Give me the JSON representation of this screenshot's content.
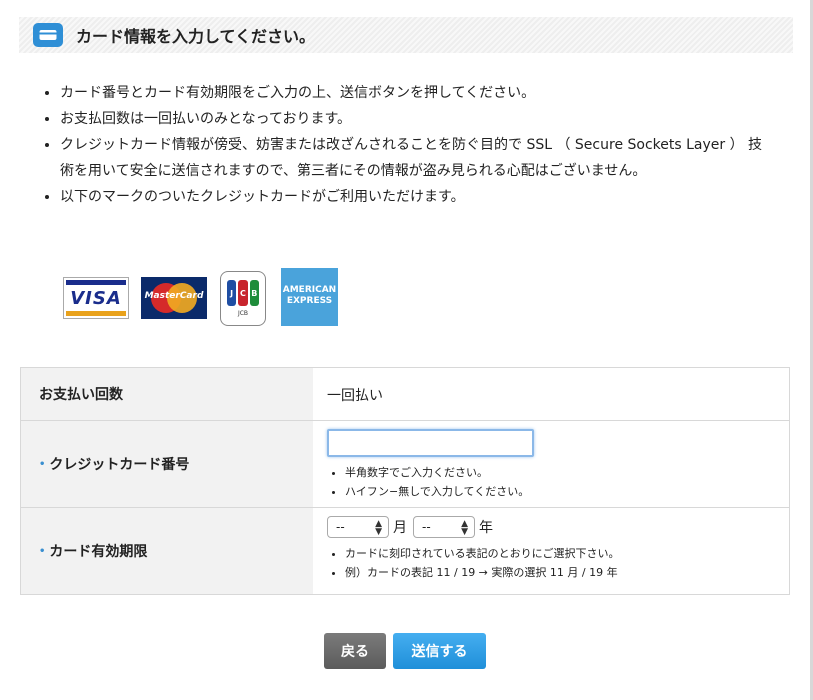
{
  "header": {
    "title": "カード情報を入力してください。"
  },
  "notices": [
    "カード番号とカード有効期限をご入力の上、送信ボタンを押してください。",
    "お支払回数は一回払いのみとなっております。",
    "クレジットカード情報が傍受、妨害または改ざんされることを防ぐ目的で SSL （ Secure Sockets Layer ） 技術を用いて安全に送信されますので、第三者にその情報が盗み見られる心配はございません。",
    "以下のマークのついたクレジットカードがご利用いただけます。"
  ],
  "card_brands": {
    "visa": "VISA",
    "mastercard": "MasterCard",
    "jcb": "JCB",
    "amex": "AMERICAN EXPRESS"
  },
  "form": {
    "payment_count": {
      "label": "お支払い回数",
      "value": "一回払い"
    },
    "card_number": {
      "required_mark": "•",
      "label": "クレジットカード番号",
      "value": "",
      "hints": [
        "半角数字でご入力ください。",
        "ハイフン−無しで入力してください。"
      ]
    },
    "expiry": {
      "required_mark": "•",
      "label": "カード有効期限",
      "month_value": "--",
      "month_unit": "月",
      "year_value": "--",
      "year_unit": "年",
      "hints": [
        "カードに刻印されている表記のとおりにご選択下さい。",
        "例）カードの表記 11 / 19 → 実際の選択 11 月 / 19 年"
      ]
    }
  },
  "buttons": {
    "back": "戻る",
    "submit": "送信する"
  },
  "colors": {
    "accent": "#2f8fd6",
    "submit": "#1f8fd9",
    "back": "#666666"
  }
}
